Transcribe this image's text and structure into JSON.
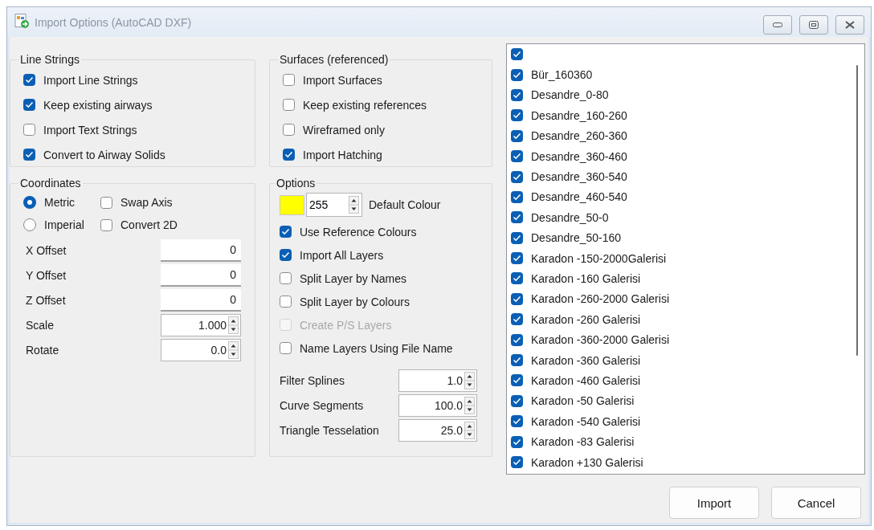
{
  "window": {
    "title": "Import Options (AutoCAD DXF)"
  },
  "line_strings": {
    "title": "Line Strings",
    "options": [
      {
        "label": "Import Line Strings",
        "checked": true
      },
      {
        "label": "Keep existing airways",
        "checked": true
      },
      {
        "label": "Import Text Strings",
        "checked": false
      },
      {
        "label": "Convert to Airway Solids",
        "checked": true
      }
    ]
  },
  "coordinates": {
    "title": "Coordinates",
    "units": [
      {
        "label": "Metric",
        "selected": true
      },
      {
        "label": "Imperial",
        "selected": false
      }
    ],
    "flags": [
      {
        "label": "Swap Axis",
        "checked": false
      },
      {
        "label": "Convert 2D",
        "checked": false
      }
    ],
    "fields": [
      {
        "label": "X Offset",
        "value": "0",
        "kind": "text"
      },
      {
        "label": "Y Offset",
        "value": "0",
        "kind": "text"
      },
      {
        "label": "Z Offset",
        "value": "0",
        "kind": "text"
      },
      {
        "label": "Scale",
        "value": "1.000",
        "kind": "spin"
      },
      {
        "label": "Rotate",
        "value": "0.0",
        "kind": "spin"
      }
    ]
  },
  "surfaces": {
    "title": "Surfaces (referenced)",
    "options": [
      {
        "label": "Import Surfaces",
        "checked": false
      },
      {
        "label": "Keep existing references",
        "checked": false
      },
      {
        "label": "Wireframed only",
        "checked": false
      },
      {
        "label": "Import Hatching",
        "checked": true
      }
    ]
  },
  "options": {
    "title": "Options",
    "default_colour": {
      "color": "#ffff00",
      "value": "255",
      "label": "Default Colour"
    },
    "flags": [
      {
        "label": "Use Reference Colours",
        "checked": true,
        "disabled": false
      },
      {
        "label": "Import All Layers",
        "checked": true,
        "disabled": false
      },
      {
        "label": "Split Layer by Names",
        "checked": false,
        "disabled": false
      },
      {
        "label": "Split Layer by Colours",
        "checked": false,
        "disabled": false
      },
      {
        "label": "Create P/S Layers",
        "checked": false,
        "disabled": true
      },
      {
        "label": "Name Layers Using File Name",
        "checked": false,
        "disabled": false
      }
    ],
    "fields": [
      {
        "label": "Filter Splines",
        "value": "1.0",
        "kind": "spin"
      },
      {
        "label": "Curve Segments",
        "value": "100.0",
        "kind": "spin"
      },
      {
        "label": "Triangle Tesselation",
        "value": "25.0",
        "kind": "spin"
      }
    ]
  },
  "layers": [
    {
      "checked": true
    },
    {
      "label": "Bür_160360",
      "checked": true
    },
    {
      "label": "Desandre_0-80",
      "checked": true
    },
    {
      "label": "Desandre_160-260",
      "checked": true
    },
    {
      "label": "Desandre_260-360",
      "checked": true
    },
    {
      "label": "Desandre_360-460",
      "checked": true
    },
    {
      "label": "Desandre_360-540",
      "checked": true
    },
    {
      "label": "Desandre_460-540",
      "checked": true
    },
    {
      "label": "Desandre_50-0",
      "checked": true
    },
    {
      "label": "Desandre_50-160",
      "checked": true
    },
    {
      "label": "Karadon -150-2000Galerisi",
      "checked": true
    },
    {
      "label": "Karadon -160 Galerisi",
      "checked": true
    },
    {
      "label": "Karadon -260-2000 Galerisi",
      "checked": true
    },
    {
      "label": "Karadon -260 Galerisi",
      "checked": true
    },
    {
      "label": "Karadon -360-2000 Galerisi",
      "checked": true
    },
    {
      "label": "Karadon -360 Galerisi",
      "checked": true
    },
    {
      "label": "Karadon -460 Galerisi",
      "checked": true
    },
    {
      "label": "Karadon -50 Galerisi",
      "checked": true
    },
    {
      "label": "Karadon -540 Galerisi",
      "checked": true
    },
    {
      "label": "Karadon -83 Galerisi",
      "checked": true
    },
    {
      "label": "Karadon +130 Galerisi",
      "checked": true
    }
  ],
  "buttons": [
    "Import",
    "Cancel"
  ]
}
